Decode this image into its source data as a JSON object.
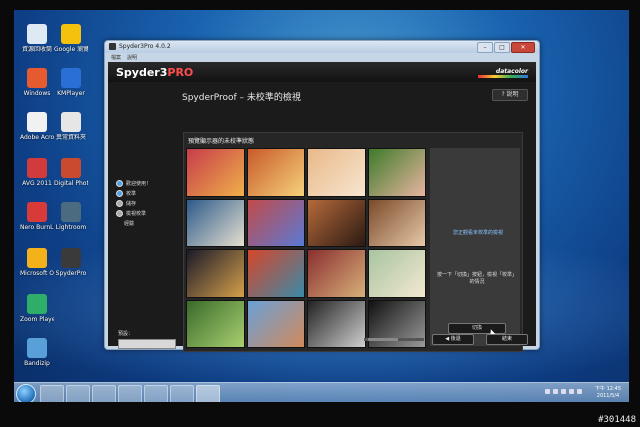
{
  "desktop": {
    "icons": [
      {
        "label": "資源回收筒",
        "color": "#dfe9f4"
      },
      {
        "label": "Google 瀏覽器",
        "color": "#f4c20d"
      },
      {
        "label": "Windows",
        "color": "#e65a2f"
      },
      {
        "label": "KMPlayer",
        "color": "#2a6fd6"
      },
      {
        "label": "Adobe Acrobat",
        "color": "#f1f1f1"
      },
      {
        "label": "異常資料夾",
        "color": "#e6e6e6"
      },
      {
        "label": "AVG 2011",
        "color": "#d23b3b"
      },
      {
        "label": "Digital Photo Pro",
        "color": "#c94a2e"
      },
      {
        "label": "Nero BurnLite 10",
        "color": "#d83a3a"
      },
      {
        "label": "Lightroom",
        "color": "#4a6b80"
      },
      {
        "label": "Microsoft Office",
        "color": "#f3b21a"
      },
      {
        "label": "SpyderPro",
        "color": "#3a3a3a"
      },
      {
        "label": "Zoom Player",
        "color": "#2fae6a"
      },
      {
        "label": "Bandizip",
        "color": "#5aa0d8"
      }
    ]
  },
  "window": {
    "title": "Spyder3Pro 4.0.2",
    "menu": [
      "檔案",
      "說明"
    ],
    "min": "–",
    "max": "□",
    "close": "✕"
  },
  "app": {
    "logo_main": "Spyder3",
    "logo_suffix": "PRO",
    "brand": "datacolor",
    "page_title": "SpyderProof – 未校準的檢視",
    "help_label": "? 說明",
    "nav": [
      {
        "label": "歡迎使用！",
        "active": true
      },
      {
        "label": "校準",
        "active": true
      },
      {
        "label": "儲存",
        "active": false
      },
      {
        "label": "檢視校準",
        "active": false
      }
    ],
    "nav_plain": "經驗",
    "preset_label": "預設：",
    "preset_value": "",
    "panel_header": "預覽顯示器的未校準狀態",
    "right_message": "您正觀看未校準的檢視",
    "right_hint": "按一下「切換」按鈕，檢視「校準」的情況",
    "switch_label": "切換",
    "back_label": "◀ 後退",
    "end_label": "結束"
  },
  "thumbnails": [
    {
      "colors": [
        "#c63c4a",
        "#f0b04a"
      ]
    },
    {
      "colors": [
        "#c85a2a",
        "#f6d27a"
      ]
    },
    {
      "colors": [
        "#e9b98a",
        "#f7e6cf"
      ]
    },
    {
      "colors": [
        "#3d7a2a",
        "#e8b5a0"
      ]
    },
    {
      "colors": [
        "#2c5a8a",
        "#e6e0d0"
      ]
    },
    {
      "colors": [
        "#c24a4a",
        "#5a7ad6"
      ]
    },
    {
      "colors": [
        "#b56a3a",
        "#2b1a12"
      ]
    },
    {
      "colors": [
        "#7a4a2a",
        "#e6c9a8"
      ]
    },
    {
      "colors": [
        "#1a1a2a",
        "#d6a04a"
      ]
    },
    {
      "colors": [
        "#d6462a",
        "#3a8aa8"
      ]
    },
    {
      "colors": [
        "#8a2f2f",
        "#d8b07a"
      ]
    },
    {
      "colors": [
        "#a8c4a0",
        "#f3e9d0"
      ]
    },
    {
      "colors": [
        "#3a6a2a",
        "#a8d070"
      ]
    },
    {
      "colors": [
        "#6aa0d8",
        "#d28a5a"
      ]
    },
    {
      "colors": [
        "#222222",
        "#cfcfcf"
      ]
    },
    {
      "colors": [
        "#111111",
        "#9a9a9a"
      ]
    },
    {
      "colors": [
        "#a8703a",
        "#e0c69a"
      ]
    },
    {
      "colors": [
        "#c0c0c0",
        "#eeeeee"
      ]
    },
    {
      "colors": [
        "#444444",
        "#dddddd"
      ]
    },
    {
      "colors": [
        "#0d0d0d",
        "#bbbbbb"
      ]
    }
  ],
  "taskbar": {
    "clock_time": "下午 12:45",
    "clock_date": "2011/5/4"
  },
  "watermark": "#301448"
}
